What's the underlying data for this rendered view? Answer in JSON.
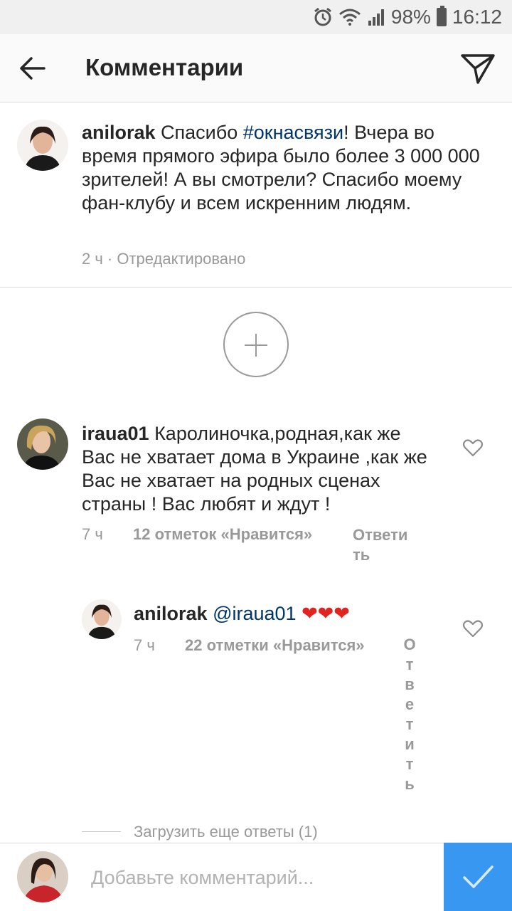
{
  "status": {
    "battery": "98%",
    "time": "16:12"
  },
  "header": {
    "title": "Комментарии"
  },
  "caption": {
    "username": "anilorak",
    "text_before": " Спасибо ",
    "hashtag": "#окнасвязи",
    "text_after": "! Вчера во время прямого эфира было более 3 000 000 зрителей! А вы смотрели? Спасибо моему фан-клубу и всем искренним людям.",
    "meta": "2 ч · Отредактировано"
  },
  "comments": [
    {
      "username": "iraua01",
      "text": " Каролиночка,родная,как же Вас не хватает дома в Украине ,как же Вас не хватает на родных сценах страны ! Вас любят и ждут !",
      "time": "7 ч",
      "likes": "12 отметок «Нравится»",
      "reply": "Ответить"
    },
    {
      "username": "anilorak",
      "mention": "@iraua01",
      "hearts": "❤❤❤",
      "time": "7 ч",
      "likes": "22 отметки «Нравится»",
      "reply": "Ответить"
    }
  ],
  "load_more": "Загрузить еще ответы (1)",
  "input": {
    "placeholder": "Добавьте комментарий..."
  }
}
